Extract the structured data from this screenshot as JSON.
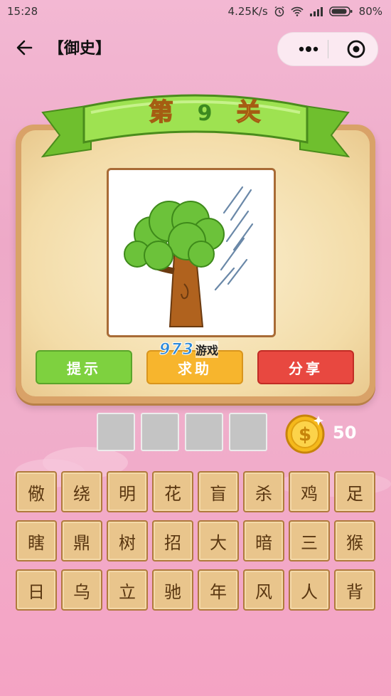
{
  "status_bar": {
    "time": "15:28",
    "net_speed": "4.25K/s",
    "battery": "80%"
  },
  "nav": {
    "title": "【御史】"
  },
  "level": {
    "prefix": "第",
    "number": "9",
    "suffix": "关"
  },
  "buttons": {
    "hint": "提示",
    "help": "求助",
    "share": "分享"
  },
  "watermark": {
    "number": "973",
    "text": "游戏"
  },
  "answer_slots": [
    "",
    "",
    "",
    ""
  ],
  "coins": "50",
  "characters": [
    [
      "儆",
      "绕",
      "明",
      "花",
      "盲",
      "杀",
      "鸡",
      "足"
    ],
    [
      "瞎",
      "鼎",
      "树",
      "招",
      "大",
      "暗",
      "三",
      "猴"
    ],
    [
      "日",
      "乌",
      "立",
      "驰",
      "年",
      "风",
      "人",
      "背"
    ]
  ],
  "colors": {
    "hint": "#7ed13f",
    "help": "#f7b52d",
    "share": "#e84840",
    "tile": "#e9c58c",
    "ribbon": "#8fd444"
  }
}
